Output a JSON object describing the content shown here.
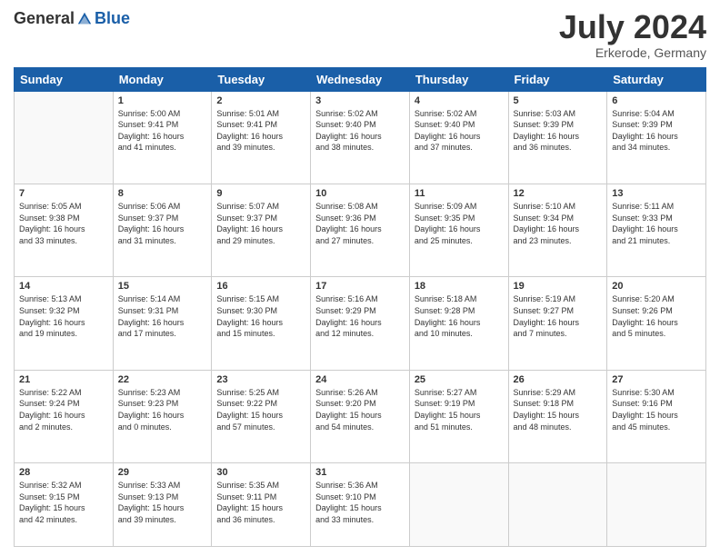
{
  "logo": {
    "general": "General",
    "blue": "Blue"
  },
  "title": "July 2024",
  "subtitle": "Erkerode, Germany",
  "days_of_week": [
    "Sunday",
    "Monday",
    "Tuesday",
    "Wednesday",
    "Thursday",
    "Friday",
    "Saturday"
  ],
  "weeks": [
    [
      {
        "day": "",
        "info": ""
      },
      {
        "day": "1",
        "info": "Sunrise: 5:00 AM\nSunset: 9:41 PM\nDaylight: 16 hours\nand 41 minutes."
      },
      {
        "day": "2",
        "info": "Sunrise: 5:01 AM\nSunset: 9:41 PM\nDaylight: 16 hours\nand 39 minutes."
      },
      {
        "day": "3",
        "info": "Sunrise: 5:02 AM\nSunset: 9:40 PM\nDaylight: 16 hours\nand 38 minutes."
      },
      {
        "day": "4",
        "info": "Sunrise: 5:02 AM\nSunset: 9:40 PM\nDaylight: 16 hours\nand 37 minutes."
      },
      {
        "day": "5",
        "info": "Sunrise: 5:03 AM\nSunset: 9:39 PM\nDaylight: 16 hours\nand 36 minutes."
      },
      {
        "day": "6",
        "info": "Sunrise: 5:04 AM\nSunset: 9:39 PM\nDaylight: 16 hours\nand 34 minutes."
      }
    ],
    [
      {
        "day": "7",
        "info": "Sunrise: 5:05 AM\nSunset: 9:38 PM\nDaylight: 16 hours\nand 33 minutes."
      },
      {
        "day": "8",
        "info": "Sunrise: 5:06 AM\nSunset: 9:37 PM\nDaylight: 16 hours\nand 31 minutes."
      },
      {
        "day": "9",
        "info": "Sunrise: 5:07 AM\nSunset: 9:37 PM\nDaylight: 16 hours\nand 29 minutes."
      },
      {
        "day": "10",
        "info": "Sunrise: 5:08 AM\nSunset: 9:36 PM\nDaylight: 16 hours\nand 27 minutes."
      },
      {
        "day": "11",
        "info": "Sunrise: 5:09 AM\nSunset: 9:35 PM\nDaylight: 16 hours\nand 25 minutes."
      },
      {
        "day": "12",
        "info": "Sunrise: 5:10 AM\nSunset: 9:34 PM\nDaylight: 16 hours\nand 23 minutes."
      },
      {
        "day": "13",
        "info": "Sunrise: 5:11 AM\nSunset: 9:33 PM\nDaylight: 16 hours\nand 21 minutes."
      }
    ],
    [
      {
        "day": "14",
        "info": "Sunrise: 5:13 AM\nSunset: 9:32 PM\nDaylight: 16 hours\nand 19 minutes."
      },
      {
        "day": "15",
        "info": "Sunrise: 5:14 AM\nSunset: 9:31 PM\nDaylight: 16 hours\nand 17 minutes."
      },
      {
        "day": "16",
        "info": "Sunrise: 5:15 AM\nSunset: 9:30 PM\nDaylight: 16 hours\nand 15 minutes."
      },
      {
        "day": "17",
        "info": "Sunrise: 5:16 AM\nSunset: 9:29 PM\nDaylight: 16 hours\nand 12 minutes."
      },
      {
        "day": "18",
        "info": "Sunrise: 5:18 AM\nSunset: 9:28 PM\nDaylight: 16 hours\nand 10 minutes."
      },
      {
        "day": "19",
        "info": "Sunrise: 5:19 AM\nSunset: 9:27 PM\nDaylight: 16 hours\nand 7 minutes."
      },
      {
        "day": "20",
        "info": "Sunrise: 5:20 AM\nSunset: 9:26 PM\nDaylight: 16 hours\nand 5 minutes."
      }
    ],
    [
      {
        "day": "21",
        "info": "Sunrise: 5:22 AM\nSunset: 9:24 PM\nDaylight: 16 hours\nand 2 minutes."
      },
      {
        "day": "22",
        "info": "Sunrise: 5:23 AM\nSunset: 9:23 PM\nDaylight: 16 hours\nand 0 minutes."
      },
      {
        "day": "23",
        "info": "Sunrise: 5:25 AM\nSunset: 9:22 PM\nDaylight: 15 hours\nand 57 minutes."
      },
      {
        "day": "24",
        "info": "Sunrise: 5:26 AM\nSunset: 9:20 PM\nDaylight: 15 hours\nand 54 minutes."
      },
      {
        "day": "25",
        "info": "Sunrise: 5:27 AM\nSunset: 9:19 PM\nDaylight: 15 hours\nand 51 minutes."
      },
      {
        "day": "26",
        "info": "Sunrise: 5:29 AM\nSunset: 9:18 PM\nDaylight: 15 hours\nand 48 minutes."
      },
      {
        "day": "27",
        "info": "Sunrise: 5:30 AM\nSunset: 9:16 PM\nDaylight: 15 hours\nand 45 minutes."
      }
    ],
    [
      {
        "day": "28",
        "info": "Sunrise: 5:32 AM\nSunset: 9:15 PM\nDaylight: 15 hours\nand 42 minutes."
      },
      {
        "day": "29",
        "info": "Sunrise: 5:33 AM\nSunset: 9:13 PM\nDaylight: 15 hours\nand 39 minutes."
      },
      {
        "day": "30",
        "info": "Sunrise: 5:35 AM\nSunset: 9:11 PM\nDaylight: 15 hours\nand 36 minutes."
      },
      {
        "day": "31",
        "info": "Sunrise: 5:36 AM\nSunset: 9:10 PM\nDaylight: 15 hours\nand 33 minutes."
      },
      {
        "day": "",
        "info": ""
      },
      {
        "day": "",
        "info": ""
      },
      {
        "day": "",
        "info": ""
      }
    ]
  ]
}
